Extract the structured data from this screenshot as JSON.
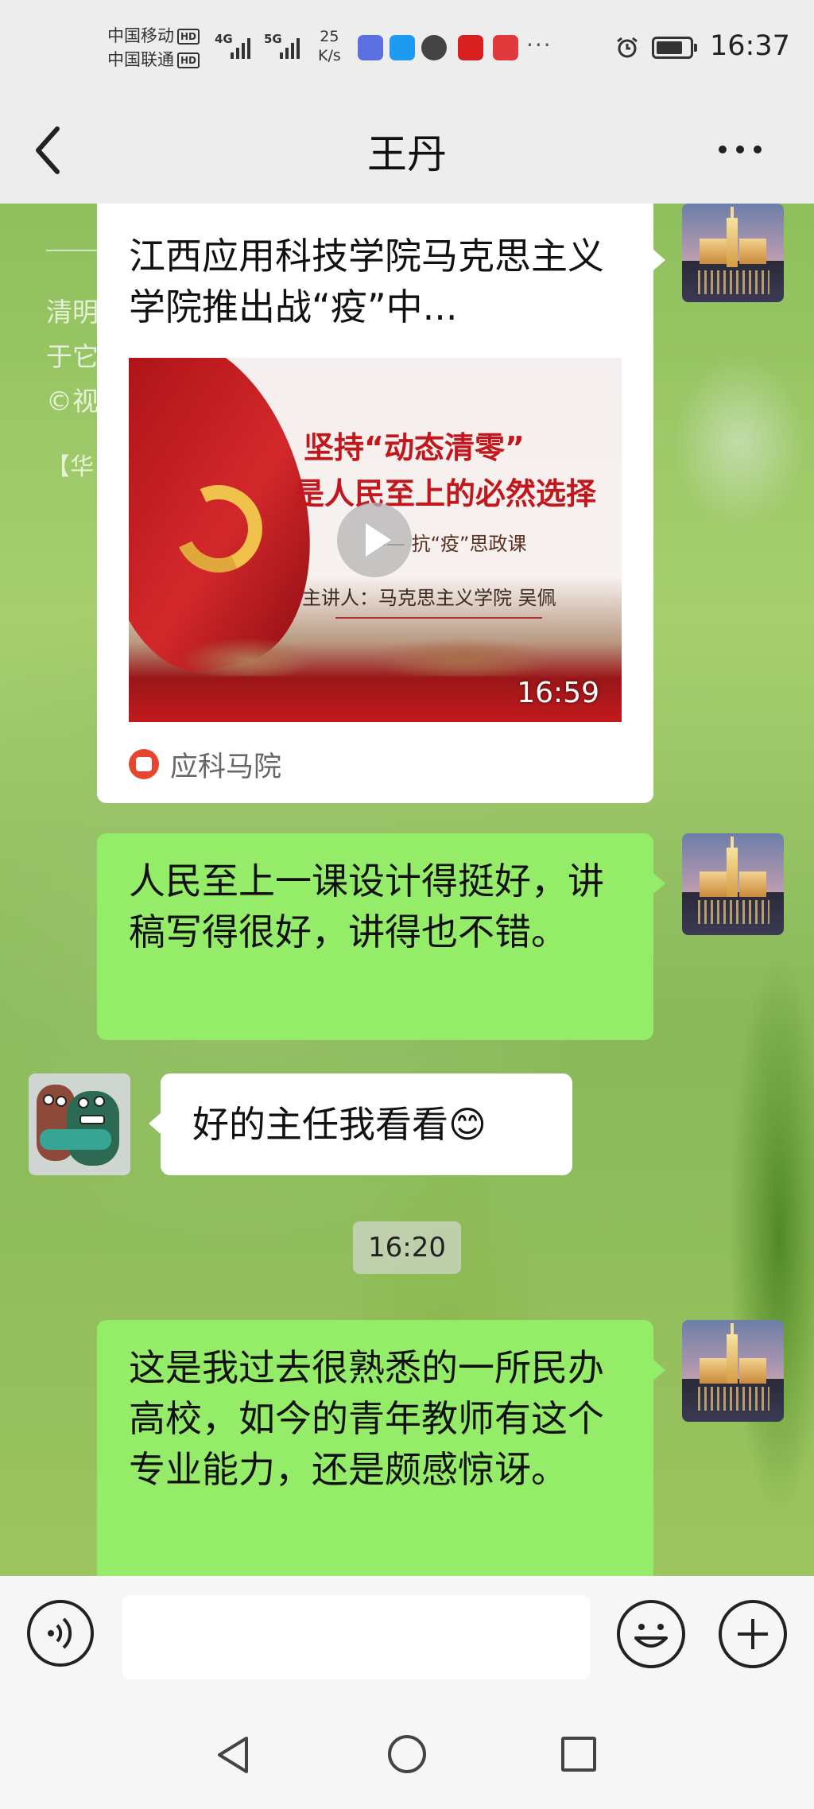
{
  "status_bar": {
    "carrier1": "中国移动",
    "carrier2": "中国联通",
    "hd": "HD",
    "net1": "4G",
    "net2": "5G",
    "speed_value": "25",
    "speed_unit": "K/s",
    "more_icons": "···",
    "time": "16:37",
    "battery_level": 0.8
  },
  "header": {
    "title": "王丹"
  },
  "background_text": {
    "line1": "清明",
    "line2": "于它",
    "line3": "©视",
    "line4": "【华"
  },
  "messages": {
    "shared_card": {
      "title": "江西应用科技学院马克思主义学院推出战“疫”中...",
      "thumb_line1": "坚持“动态清零”",
      "thumb_line2": "是人民至上的必然选择",
      "thumb_line3": "—— 抗“疫”思政课",
      "thumb_line4": "主讲人：马克思主义学院  吴佩",
      "duration": "16:59",
      "source": "应科马院"
    },
    "msg1": "人民至上一课设计得挺好，讲稿写得很好，讲得也不错。",
    "msg2": "好的主任我看看😊",
    "timestamp": "16:20",
    "msg3": "这是我过去很熟悉的一所民办高校，如今的青年教师有这个专业能力，还是颇感惊讶。"
  },
  "colors": {
    "sent_bubble": "#95ec69",
    "received_bubble": "#ffffff",
    "header_bg": "#ededed"
  }
}
